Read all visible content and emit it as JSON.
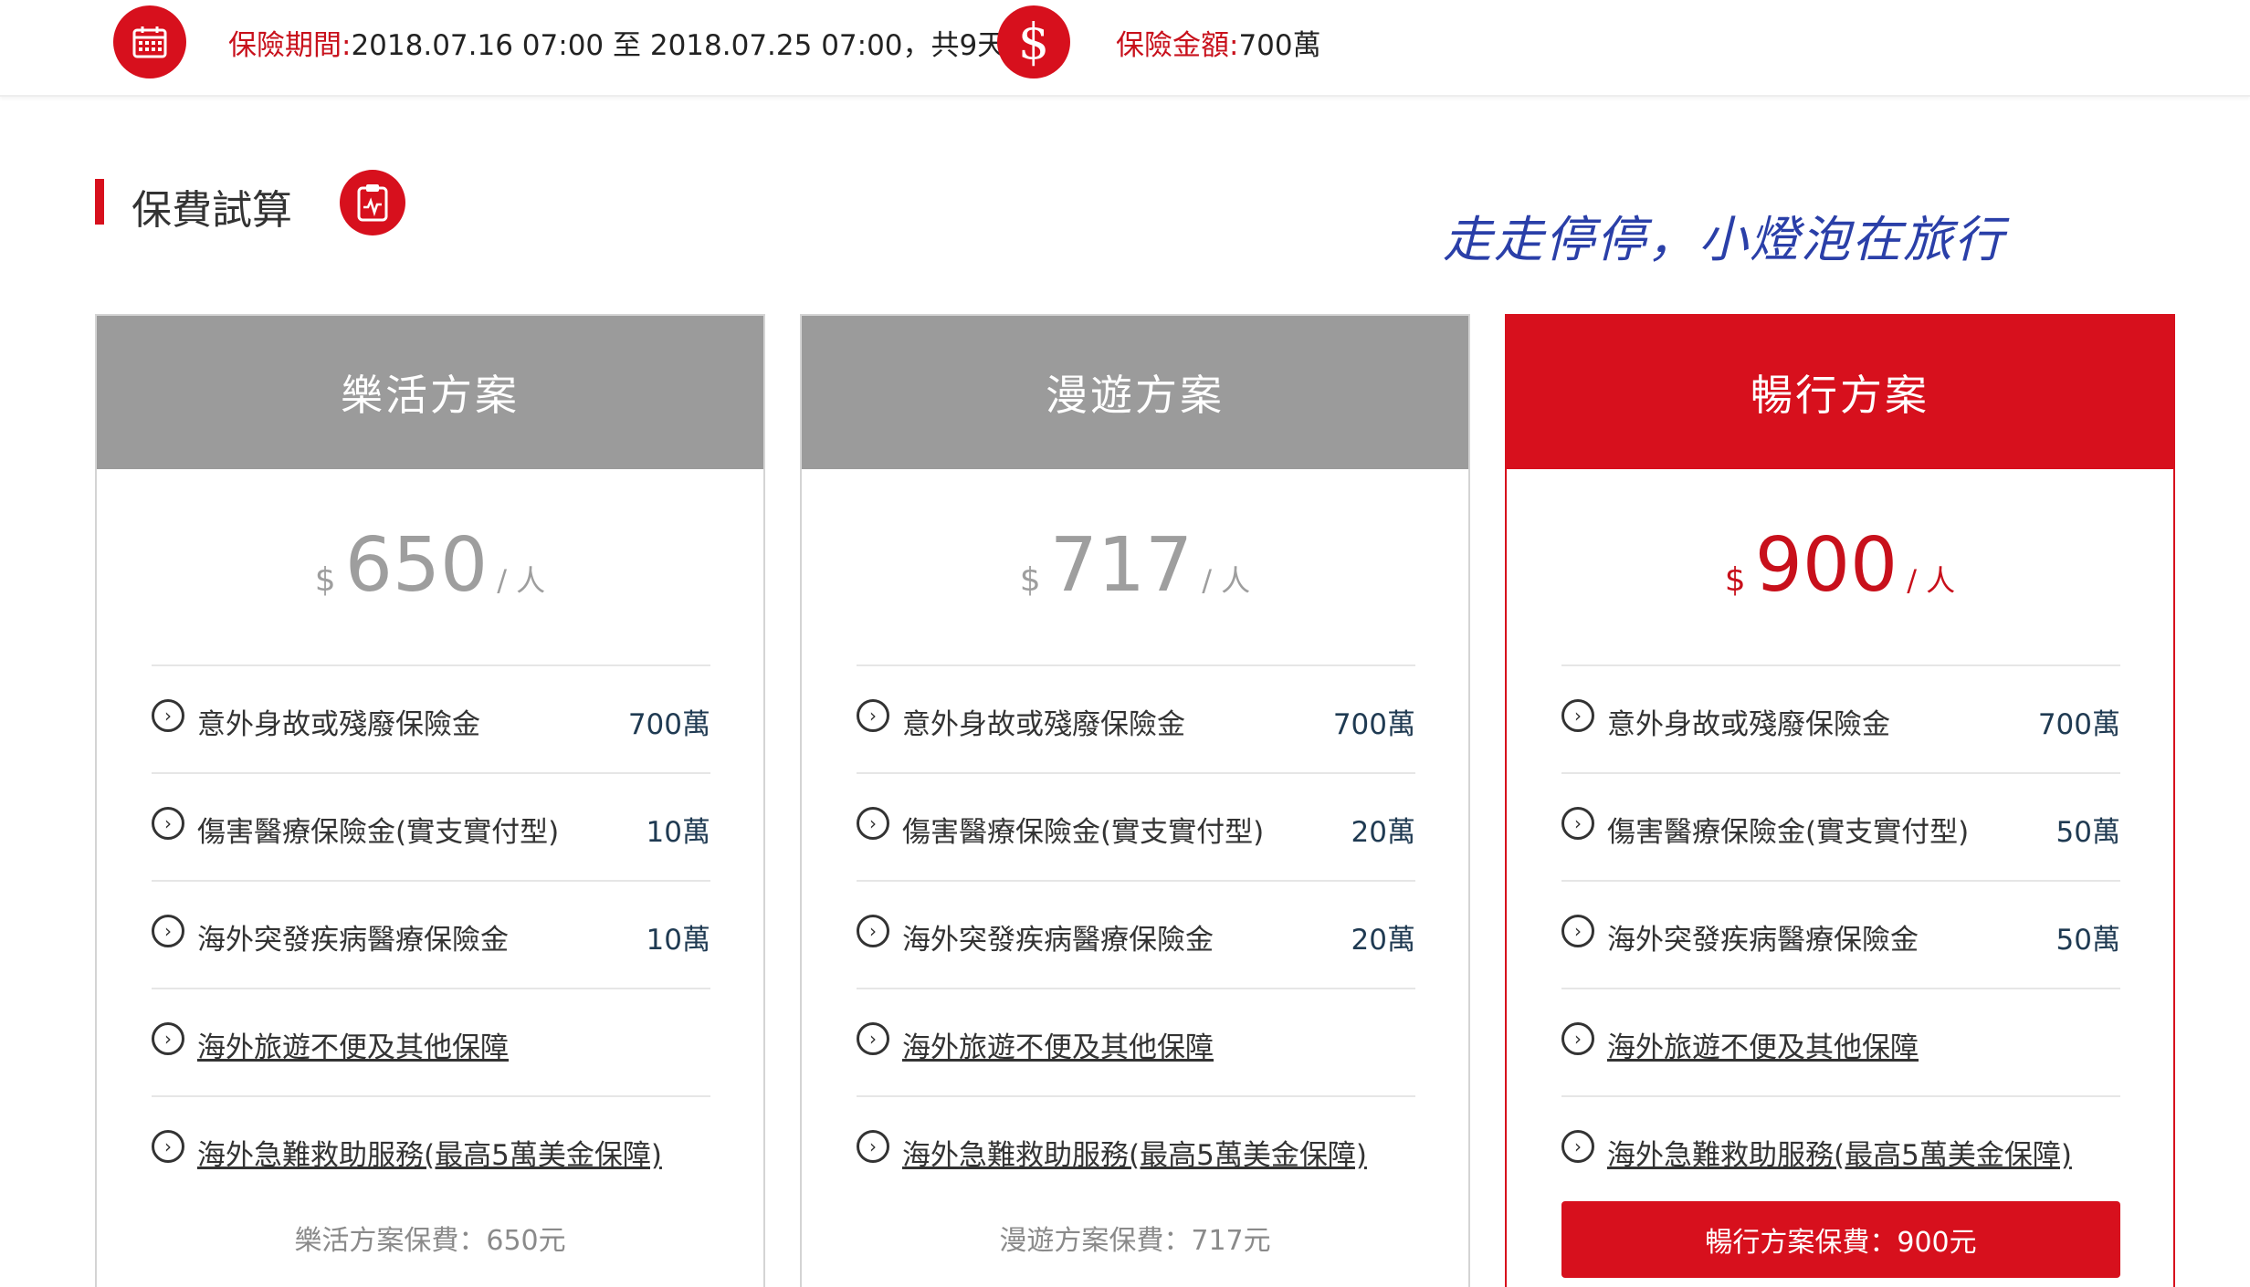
{
  "topbar": {
    "calendar_icon": "calendar-icon",
    "period_label": "保險期間:",
    "period_value": "2018.07.16 07:00 至 2018.07.25 07:00，共9天",
    "dollar_icon": "dollar-icon",
    "dollar_symbol": "$",
    "amount_label": "保險金額:",
    "amount_value": "700萬"
  },
  "section": {
    "title": "保費試算",
    "icon": "clipboard-icon"
  },
  "watermark": "走走停停，小燈泡在旅行",
  "plans": [
    {
      "name": "樂活方案",
      "currency": "$",
      "price": "650",
      "unit": "/ 人",
      "rows": [
        {
          "label": "意外身故或殘廢保險金",
          "value": "700萬"
        },
        {
          "label": "傷害醫療保險金(實支實付型)",
          "value": "10萬"
        },
        {
          "label": "海外突發疾病醫療保險金",
          "value": "10萬"
        },
        {
          "label": "海外旅遊不便及其他保障",
          "value": ""
        },
        {
          "label": "海外急難救助服務(最高5萬美金保障)",
          "value": ""
        }
      ],
      "fee": "樂活方案保費：650元",
      "selected": false
    },
    {
      "name": "漫遊方案",
      "currency": "$",
      "price": "717",
      "unit": "/ 人",
      "rows": [
        {
          "label": "意外身故或殘廢保險金",
          "value": "700萬"
        },
        {
          "label": "傷害醫療保險金(實支實付型)",
          "value": "20萬"
        },
        {
          "label": "海外突發疾病醫療保險金",
          "value": "20萬"
        },
        {
          "label": "海外旅遊不便及其他保障",
          "value": ""
        },
        {
          "label": "海外急難救助服務(最高5萬美金保障)",
          "value": ""
        }
      ],
      "fee": "漫遊方案保費：717元",
      "selected": false
    },
    {
      "name": "暢行方案",
      "currency": "$",
      "price": "900",
      "unit": "/ 人",
      "rows": [
        {
          "label": "意外身故或殘廢保險金",
          "value": "700萬"
        },
        {
          "label": "傷害醫療保險金(實支實付型)",
          "value": "50萬"
        },
        {
          "label": "海外突發疾病醫療保險金",
          "value": "50萬"
        },
        {
          "label": "海外旅遊不便及其他保障",
          "value": ""
        },
        {
          "label": "海外急難救助服務(最高5萬美金保障)",
          "value": ""
        }
      ],
      "fee": "暢行方案保費：900元",
      "selected": true
    }
  ],
  "colors": {
    "accent": "#d7101d",
    "header_gray": "#9b9b9b",
    "value_text": "#1f3a52"
  }
}
